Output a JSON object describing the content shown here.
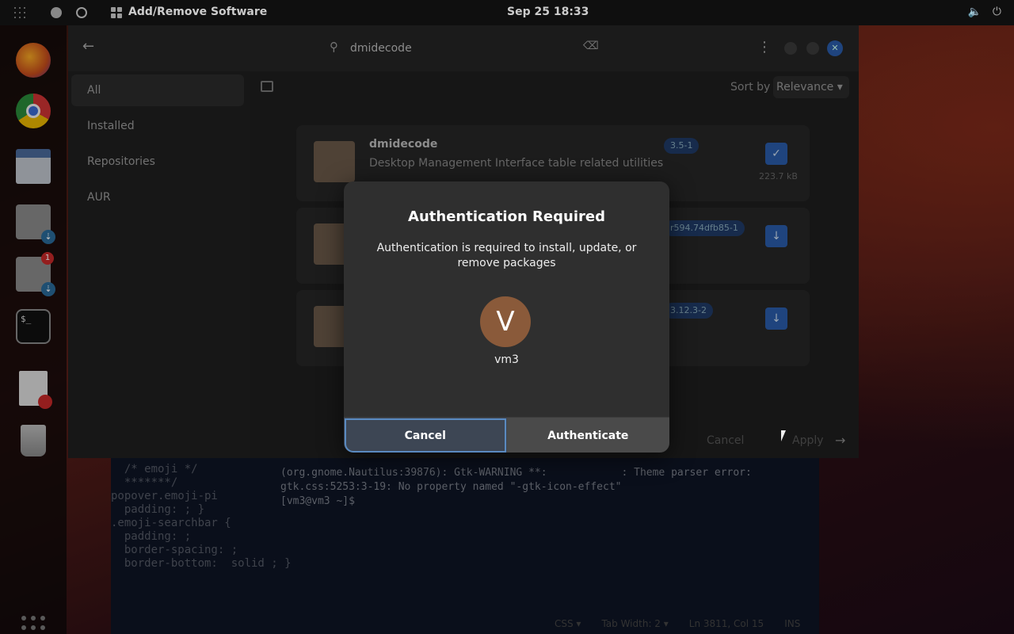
{
  "topbar": {
    "app_title": "Add/Remove Software",
    "clock": "Sep 25  18:33",
    "tray": [
      "🔈",
      "⏻"
    ]
  },
  "dock": {
    "items": [
      {
        "name": "firefox-icon",
        "color": "#c44b1b"
      },
      {
        "name": "chrome-icon",
        "color": "#2a7a3a"
      },
      {
        "name": "files-icon",
        "color": "#3a5a8a"
      },
      {
        "name": "software-icon",
        "color": "#6a6a6a",
        "sub": "⇣"
      },
      {
        "name": "software-update-icon",
        "color": "#6a6a6a",
        "badge": "1",
        "sub": "⇣"
      },
      {
        "name": "terminal-icon",
        "color": "#111111",
        "text": "$_"
      },
      {
        "name": "text-editor-icon",
        "color": "#dddddd"
      },
      {
        "name": "trash-icon",
        "color": "#aaaaaa"
      }
    ]
  },
  "app": {
    "search_value": "dmidecode",
    "sidebar": [
      "All",
      "Installed",
      "Repositories",
      "AUR"
    ],
    "sort_label": "Sort by",
    "sort_value": "Relevance",
    "packages": [
      {
        "name": "dmidecode",
        "desc": "Desktop Management Interface table related utilities",
        "version": "3.5-1",
        "size": "223.7 kB",
        "state": "installed"
      },
      {
        "name": "",
        "desc": "",
        "version": "r594.74dfb85-1",
        "size": "",
        "state": "install"
      },
      {
        "name": "",
        "desc": "",
        "version": "3.12.3-2",
        "size": "",
        "state": "install"
      }
    ],
    "footer_cancel": "Cancel",
    "footer_apply": "Apply"
  },
  "editor": {
    "code_lines": [
      "  /* emoji */",
      "  *******/",
      "popover.emoji-pi",
      "  padding: ; }",
      "",
      ".emoji-searchbar {",
      "  padding: ;",
      "  border-spacing: ;",
      "  border-bottom:  solid ; }"
    ],
    "terminal": "(org.gnome.Nautilus:39876): Gtk-WARNING **:            : Theme parser error: gtk.css:5253:3-19: No property named \"-gtk-icon-effect\"\n[vm3@vm3 ~]$ ",
    "status": [
      "CSS ▾",
      "Tab Width: 2 ▾",
      "Ln 3811, Col 15",
      "INS"
    ]
  },
  "dialog": {
    "title": "Authentication Required",
    "message": "Authentication is required to install, update, or remove packages",
    "avatar_letter": "V",
    "username": "vm3",
    "cancel_label": "Cancel",
    "authenticate_label": "Authenticate"
  }
}
